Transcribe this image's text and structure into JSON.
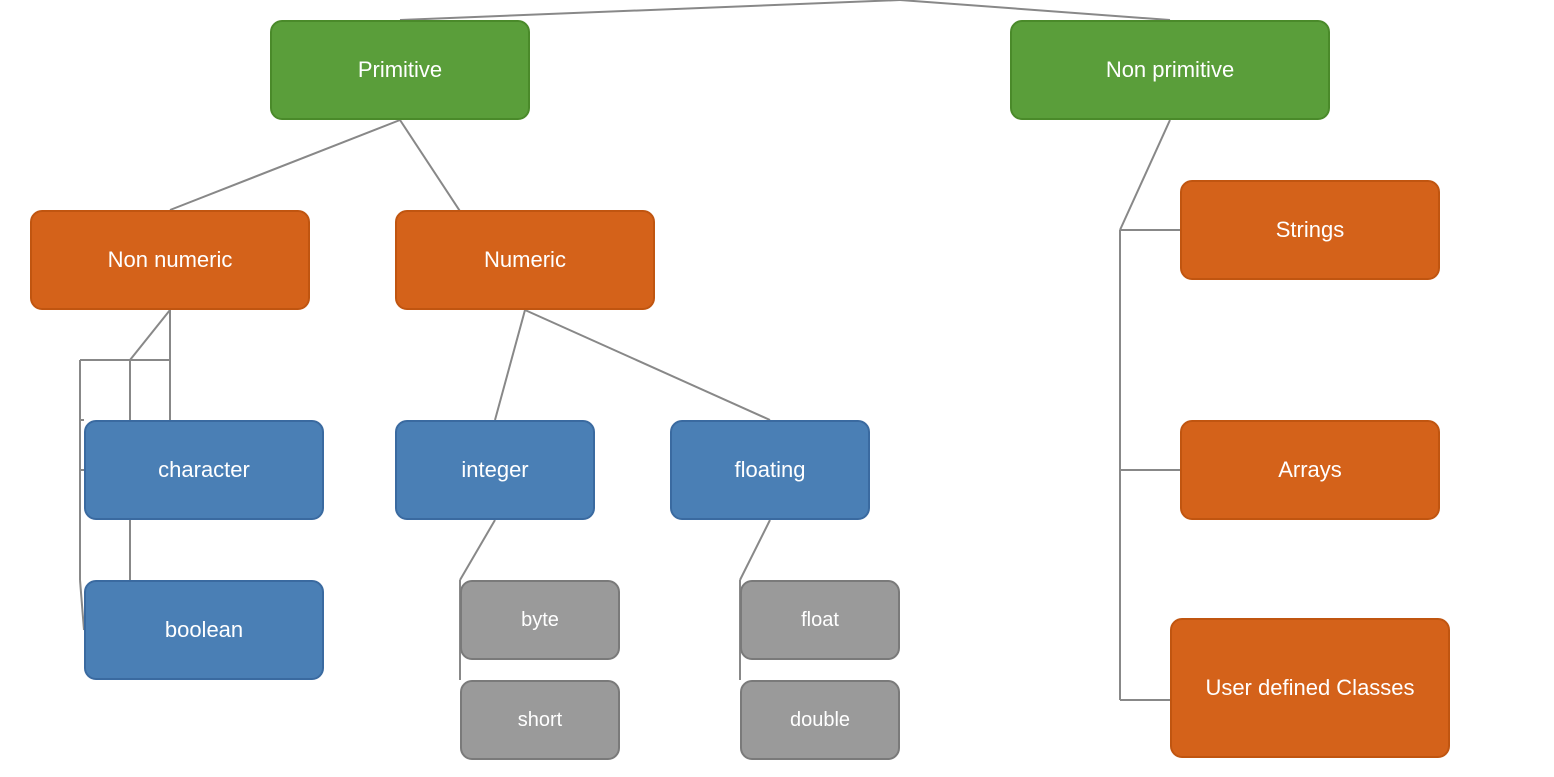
{
  "nodes": {
    "primitive": "Primitive",
    "nonprimitive": "Non primitive",
    "nonnumeric": "Non numeric",
    "numeric": "Numeric",
    "strings": "Strings",
    "arrays": "Arrays",
    "udclasses": "User defined Classes",
    "character": "character",
    "boolean": "boolean",
    "integer": "integer",
    "floating": "floating",
    "byte": "byte",
    "short": "short",
    "float": "float",
    "double": "double"
  }
}
